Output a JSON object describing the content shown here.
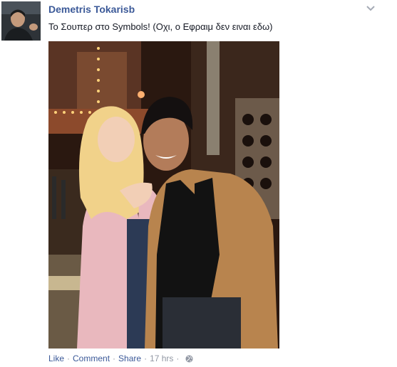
{
  "post": {
    "author": "Demetris Tokarisb",
    "text": "Το Σουπερ στο Symbols! (Οχι, ο Εφραιμ δεν ειναι εδω)",
    "privacy_icon": "globe-icon",
    "menu_icon": "chevron-down-icon"
  },
  "actions": {
    "like": "Like",
    "comment": "Comment",
    "share": "Share",
    "separator": "·",
    "timestamp": "17 hrs",
    "separator2": "·"
  },
  "colors": {
    "link": "#3b5998",
    "meta": "#9197a3",
    "text": "#141823"
  }
}
